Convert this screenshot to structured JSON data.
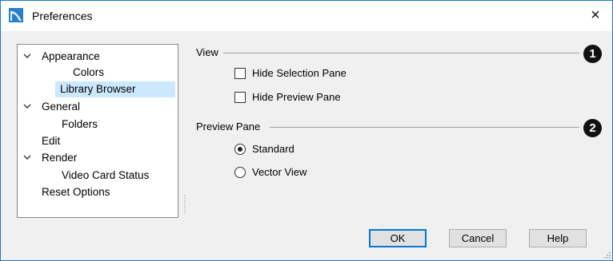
{
  "window": {
    "title": "Preferences",
    "app_icon": "chief-architect-icon",
    "close_glyph": "×"
  },
  "tree": {
    "items": [
      {
        "label": "Appearance",
        "expanded": true
      },
      {
        "label": "Colors"
      },
      {
        "label": "Library Browser",
        "selected": true
      },
      {
        "label": "General",
        "expanded": true
      },
      {
        "label": "Folders"
      },
      {
        "label": "Edit"
      },
      {
        "label": "Render",
        "expanded": true
      },
      {
        "label": "Video Card Status"
      },
      {
        "label": "Reset Options"
      }
    ]
  },
  "view_section": {
    "label": "View",
    "callout": "1",
    "options": [
      {
        "label": "Hide Selection Pane",
        "checked": false
      },
      {
        "label": "Hide Preview Pane",
        "checked": false
      }
    ]
  },
  "preview_section": {
    "label": "Preview Pane",
    "callout": "2",
    "options": [
      {
        "label": "Standard",
        "selected": true
      },
      {
        "label": "Vector View",
        "selected": false
      }
    ]
  },
  "buttons": {
    "ok": "OK",
    "cancel": "Cancel",
    "help": "Help"
  },
  "colors": {
    "accent": "#0078d7",
    "selection": "#cce8ff"
  }
}
